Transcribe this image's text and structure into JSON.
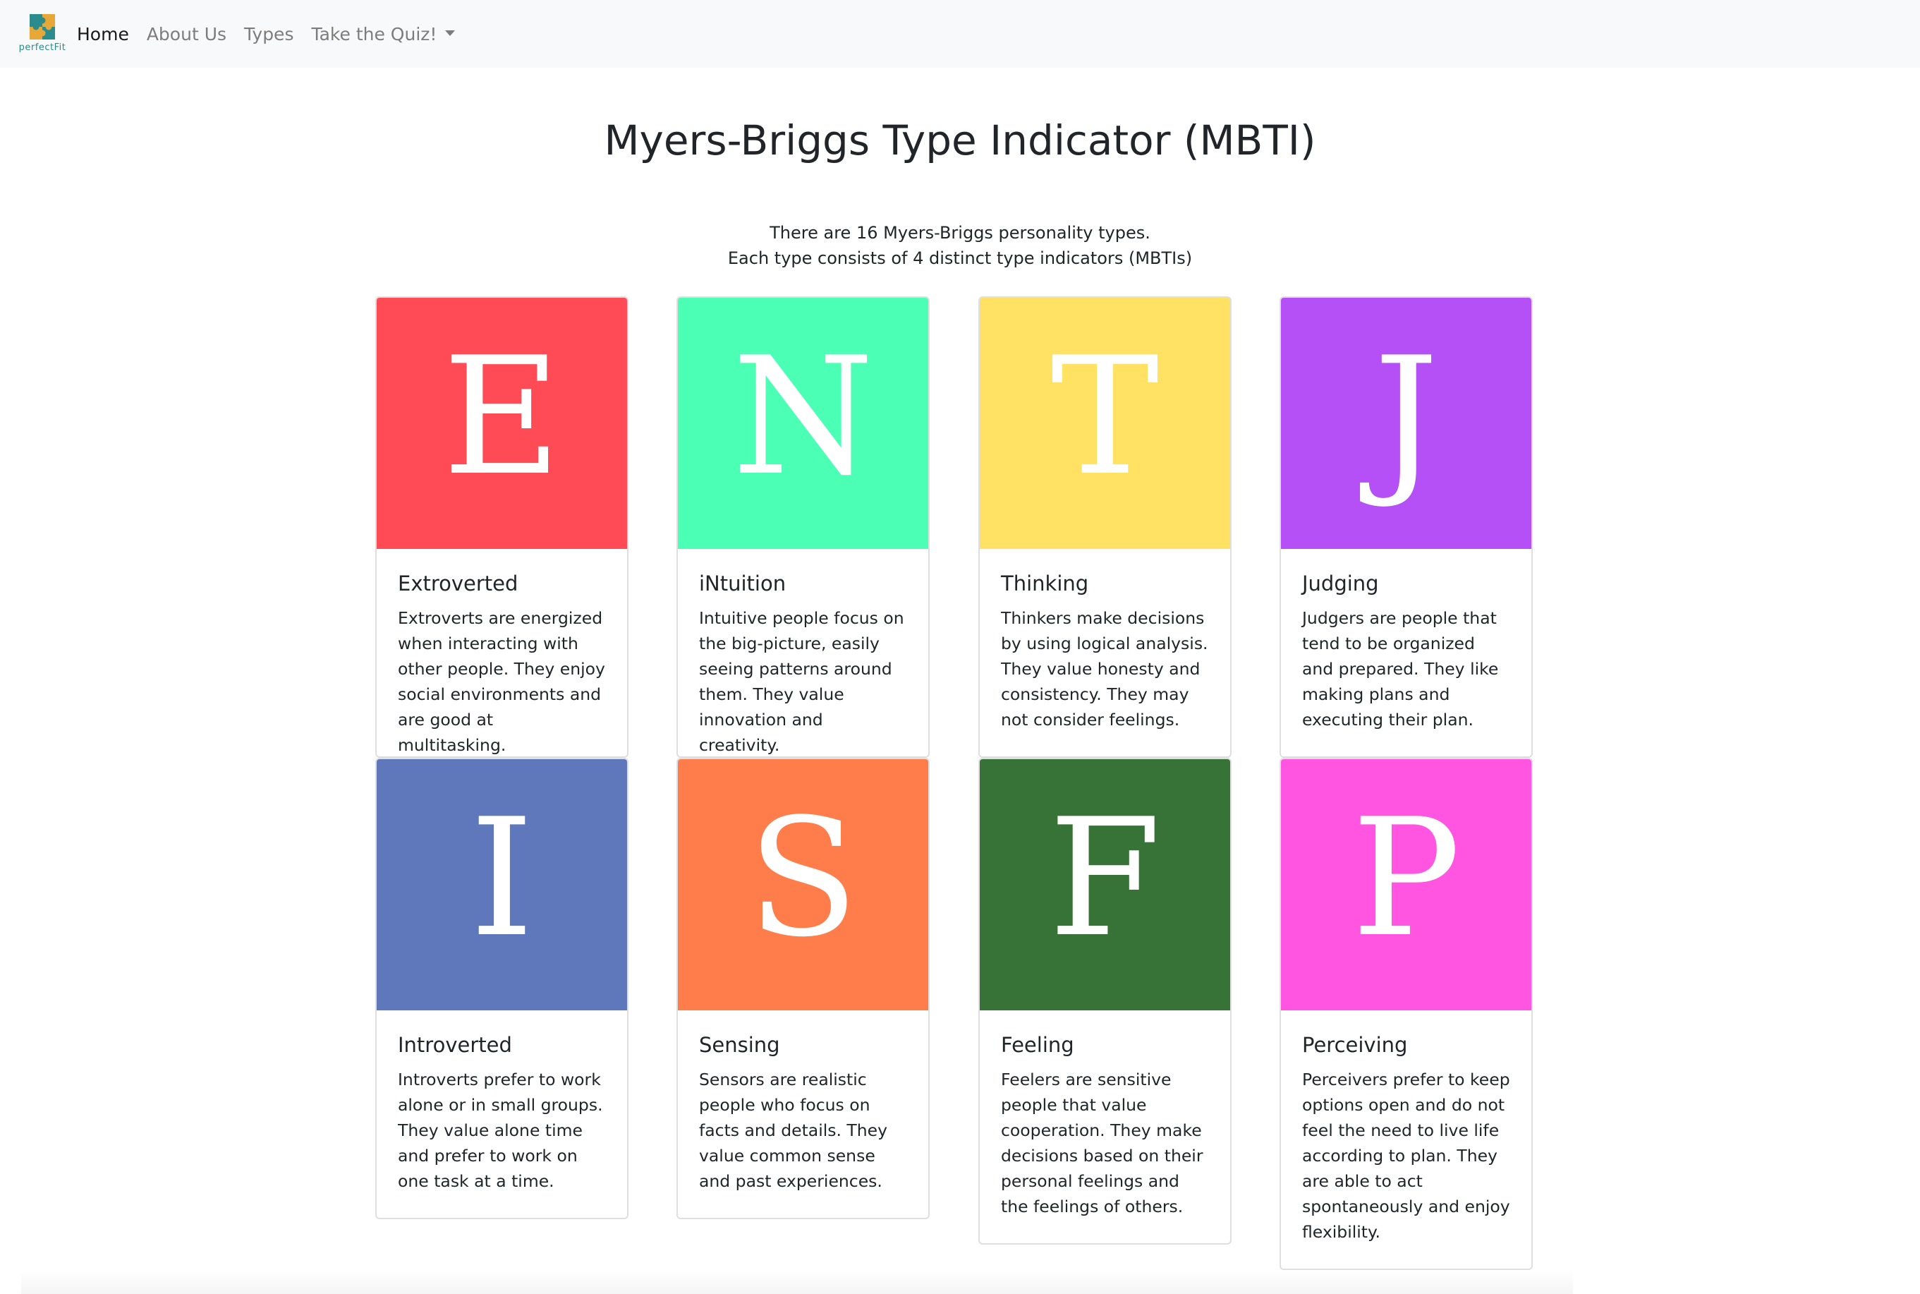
{
  "nav": {
    "brand_text": "perfectFit",
    "links": [
      {
        "label": "Home",
        "active": true
      },
      {
        "label": "About Us",
        "active": false
      },
      {
        "label": "Types",
        "active": false
      },
      {
        "label": "Take the Quiz!",
        "active": false,
        "dropdown": true
      }
    ]
  },
  "main": {
    "title": "Myers-Briggs Type Indicator (MBTI)",
    "intro_line1": "There are 16 Myers-Briggs personality types.",
    "intro_line2": "Each type consists of 4 distinct type indicators (MBTIs)"
  },
  "cards": [
    {
      "letter": "E",
      "title": "Extroverted",
      "color": "#ff4b55",
      "text": "Extroverts are energized when interacting with other people. They enjoy social environments and are good at multitasking."
    },
    {
      "letter": "N",
      "title": "iNtuition",
      "color": "#4bffb4",
      "text": "Intuitive people focus on the big-picture, easily seeing patterns around them. They value innovation and creativity."
    },
    {
      "letter": "T",
      "title": "Thinking",
      "color": "#ffe164",
      "text": "Thinkers make decisions by using logical analysis. They value honesty and consistency. They may not consider feelings."
    },
    {
      "letter": "J",
      "title": "Judging",
      "color": "#b450f5",
      "text": "Judgers are people that tend to be organized and prepared. They like making plans and executing their plan."
    },
    {
      "letter": "I",
      "title": "Introverted",
      "color": "#5f78bc",
      "text": "Introverts prefer to work alone or in small groups. They value alone time and prefer to work on one task at a time."
    },
    {
      "letter": "S",
      "title": "Sensing",
      "color": "#ff7d4b",
      "text": "Sensors are realistic people who focus on facts and details. They value common sense and past experiences."
    },
    {
      "letter": "F",
      "title": "Feeling",
      "color": "#377337",
      "text": "Feelers are sensitive people that value cooperation. They make decisions based on their personal feelings and the feelings of others."
    },
    {
      "letter": "P",
      "title": "Perceiving",
      "color": "#ff55e1",
      "text": "Perceivers prefer to keep options open and do not feel the need to live life according to plan. They are able to act spontaneously and enjoy flexibility."
    }
  ]
}
